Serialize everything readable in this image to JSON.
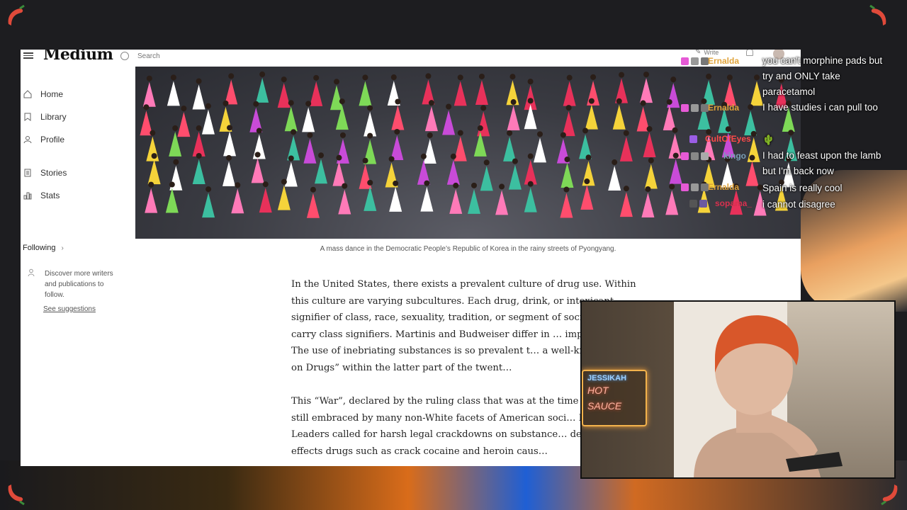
{
  "browser": {
    "logo": "Medium",
    "search_placeholder": "Search",
    "write_label": "Write"
  },
  "sidebar": {
    "items": [
      {
        "label": "Home",
        "icon": "home-icon"
      },
      {
        "label": "Library",
        "icon": "bookmark-icon"
      },
      {
        "label": "Profile",
        "icon": "profile-icon"
      },
      {
        "label": "Stories",
        "icon": "stories-icon"
      },
      {
        "label": "Stats",
        "icon": "stats-icon"
      }
    ],
    "following_label": "Following",
    "discover_text": "Discover more writers and publications to follow.",
    "see_suggestions": "See suggestions"
  },
  "article": {
    "caption": "A mass dance in the Democratic People’s Republic of Korea in the rainy streets of Pyongyang.",
    "paragraphs": [
      "In the United States, there exists a prevalent culture of drug use. Within this culture are varying subcultures. Each drug, drink, or intoxicant…signifier of class, race, sexuality, tradition, or segment of societ… cocaine carry class signifiers. Martinis and Budweiser differ in … implications. The use of inebriating substances is so prevalent t… a well-known “War on Drugs” within the latter part of the twent…",
      "This “War”, declared by the ruling class that was at the time larg… was still embraced by many non-White facets of American soci… Brown Leaders called for harsh legal crackdowns on substance… devastating effects drugs such as crack cocaine and heroin caus…"
    ]
  },
  "chat": {
    "messages": [
      {
        "user": "Ernalda",
        "user_color": "#e0a33a",
        "text": "you can't morphine pads but try and ONLY take paracetamol"
      },
      {
        "user": "Ernalda",
        "user_color": "#e0a33a",
        "text": "I have studies i can pull too"
      },
      {
        "user": "CultOfEyes",
        "user_color": "#ff4a4a",
        "text": "🌵"
      },
      {
        "user": "kingo",
        "user_color": "#7aa0b8",
        "text": "I had to feast upon the lamb but I'm back now"
      },
      {
        "user": "Ernalda",
        "user_color": "#e0a33a",
        "text": "Spain is really cool"
      },
      {
        "user": "sopama_",
        "user_color": "#d9304f",
        "text": "i cannot disagree"
      }
    ]
  },
  "webcam": {
    "sign_line1": "JESSIKAH",
    "sign_line2": "HOT",
    "sign_line3": "SAUCE"
  },
  "colors": {
    "accent_pepper": "#e04a3a",
    "chat_text": "#ffffff"
  }
}
